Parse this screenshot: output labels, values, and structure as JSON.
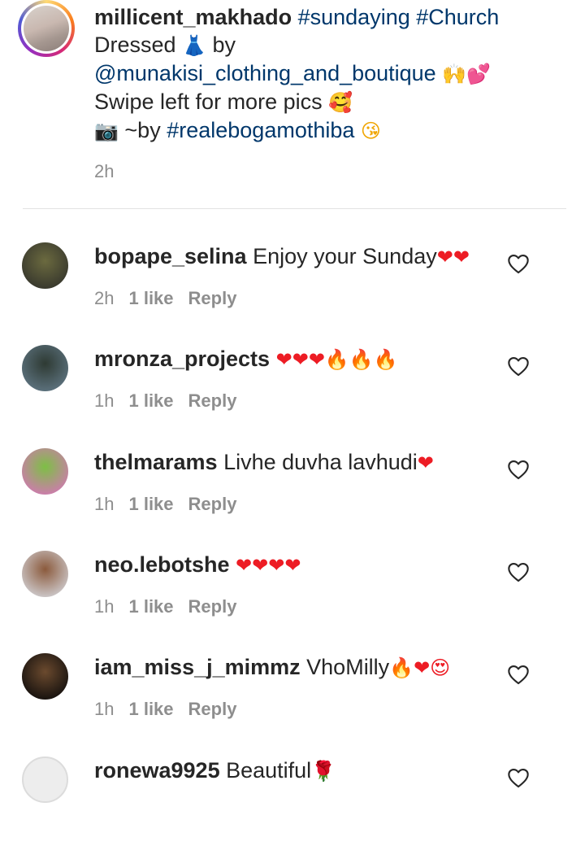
{
  "caption": {
    "username": "millicent_makhado",
    "tags_line1": "#sundaying #Church",
    "line2_prefix": "Dressed",
    "dress_emoji": "👗",
    "line2_suffix": "by",
    "mention": "@munakisi_clothing_and_boutique",
    "mention_emojis": "🙌💕",
    "line4": "Swipe left for more pics",
    "line4_emoji": "🥰",
    "camera_emoji": "📷",
    "line5_prefix": "~by",
    "line5_tag": "#realebogamothiba",
    "line5_emoji": "😘",
    "time": "2h"
  },
  "comments": [
    {
      "username": "bopape_selina",
      "text": "Enjoy your Sunday",
      "emojis": "❤❤",
      "time": "2h",
      "likes": "1 like",
      "reply": "Reply",
      "avatar_colors": [
        "#3a3a2e",
        "#6b6a3f"
      ]
    },
    {
      "username": "mronza_projects",
      "text": "",
      "emojis": "❤❤❤🔥🔥🔥",
      "time": "1h",
      "likes": "1 like",
      "reply": "Reply",
      "avatar_colors": [
        "#5a6f7a",
        "#2e3a33"
      ]
    },
    {
      "username": "thelmarams",
      "text": "Livhe duvha lavhudi",
      "emojis": "❤",
      "time": "1h",
      "likes": "1 like",
      "reply": "Reply",
      "avatar_colors": [
        "#c97fa8",
        "#7dbf45"
      ]
    },
    {
      "username": "neo.lebotshe",
      "text": "",
      "emojis": "❤❤❤❤",
      "time": "1h",
      "likes": "1 like",
      "reply": "Reply",
      "avatar_colors": [
        "#c9c2c2",
        "#8b5a3c"
      ]
    },
    {
      "username": "iam_miss_j_mimmz",
      "text": "VhoMilly",
      "emojis": "🔥❤😍",
      "time": "1h",
      "likes": "1 like",
      "reply": "Reply",
      "avatar_colors": [
        "#1a1410",
        "#6b4a2e"
      ]
    },
    {
      "username": "ronewa9925",
      "text": "Beautiful",
      "emojis": "🌹",
      "time": "",
      "likes": "",
      "reply": "",
      "avatar_colors": [
        "#eeeeee",
        "#d0d0d0"
      ]
    }
  ],
  "icons": {
    "like": "heart-outline-icon"
  },
  "colors": {
    "link": "#00376b",
    "meta": "#8e8e8e",
    "text": "#262626"
  }
}
